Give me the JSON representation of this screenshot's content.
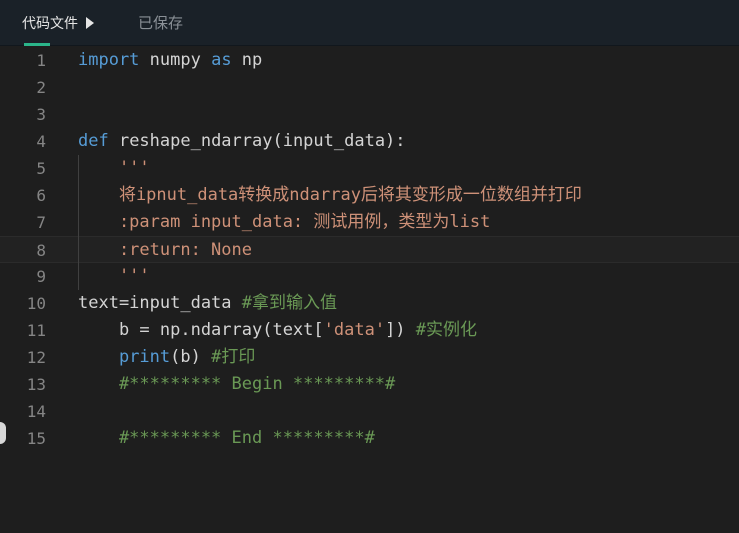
{
  "header": {
    "file_tab_label": "代码文件",
    "status_text": "已保存"
  },
  "editor": {
    "lines": [
      {
        "number": "1"
      },
      {
        "number": "2"
      },
      {
        "number": "3"
      },
      {
        "number": "4"
      },
      {
        "number": "5"
      },
      {
        "number": "6"
      },
      {
        "number": "7"
      },
      {
        "number": "8"
      },
      {
        "number": "9"
      },
      {
        "number": "10"
      },
      {
        "number": "11"
      },
      {
        "number": "12"
      },
      {
        "number": "13"
      },
      {
        "number": "14"
      },
      {
        "number": "15"
      }
    ],
    "tokens": {
      "l1_import": "import",
      "l1_mod": " numpy ",
      "l1_as": "as",
      "l1_np": " np",
      "l4_def": "def",
      "l4_sig": " reshape_ndarray(input_data):",
      "l5_doc": "    '''",
      "l6_doc": "    将ipnut_data转换成ndarray后将其变形成一位数组并打印",
      "l7_doc": "    :param input_data: 测试用例，类型为list",
      "l8_doc": "    :return: None",
      "l9_doc": "    '''",
      "l10_code": "text=input_data ",
      "l10_com": "#拿到输入值",
      "l11_code_a": "    b = np.ndarray(text[",
      "l11_str": "'data'",
      "l11_code_b": "]) ",
      "l11_com": "#实例化",
      "l12_indent": "    ",
      "l12_print": "print",
      "l12_code": "(b) ",
      "l12_com": "#打印",
      "l13_com": "    #********* Begin *********#",
      "l15_com": "    #********* End *********#"
    },
    "active_line": 8
  },
  "colors": {
    "keyword": "#569cd6",
    "string": "#ce9178",
    "comment": "#6a9955",
    "accent": "#2bb58a"
  }
}
